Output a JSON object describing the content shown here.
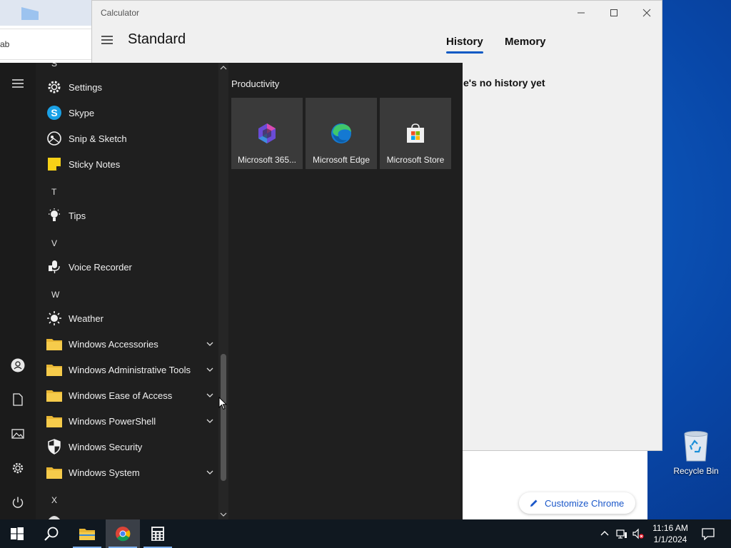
{
  "browser": {
    "address_fragment": "ab",
    "customize_label": "Customize Chrome"
  },
  "calculator": {
    "title": "Calculator",
    "mode": "Standard",
    "tabs": [
      {
        "label": "History",
        "active": true
      },
      {
        "label": "Memory",
        "active": false
      }
    ],
    "history_empty": "e's no history yet"
  },
  "start_menu": {
    "letters": {
      "s": "S",
      "t": "T",
      "v": "V",
      "w": "W",
      "x": "X"
    },
    "apps": [
      {
        "label": "Settings",
        "icon": "gear-icon"
      },
      {
        "label": "Skype",
        "icon": "skype-icon"
      },
      {
        "label": "Snip & Sketch",
        "icon": "snip-sketch-icon"
      },
      {
        "label": "Sticky Notes",
        "icon": "sticky-notes-icon"
      },
      {
        "label": "Tips",
        "icon": "lightbulb-icon"
      },
      {
        "label": "Voice Recorder",
        "icon": "microphone-icon"
      },
      {
        "label": "Weather",
        "icon": "sun-icon"
      },
      {
        "label": "Windows Accessories",
        "icon": "folder-icon",
        "expandable": true
      },
      {
        "label": "Windows Administrative Tools",
        "icon": "folder-icon",
        "expandable": true
      },
      {
        "label": "Windows Ease of Access",
        "icon": "folder-icon",
        "expandable": true
      },
      {
        "label": "Windows PowerShell",
        "icon": "folder-icon",
        "expandable": true
      },
      {
        "label": "Windows Security",
        "icon": "shield-icon"
      },
      {
        "label": "Windows System",
        "icon": "folder-icon",
        "expandable": true
      }
    ],
    "tiles_group": "Productivity",
    "tiles": [
      {
        "label": "Microsoft 365...",
        "icon": "microsoft-365-icon"
      },
      {
        "label": "Microsoft Edge",
        "icon": "edge-icon"
      },
      {
        "label": "Microsoft Store",
        "icon": "store-icon"
      }
    ]
  },
  "desktop": {
    "recycle_bin_label": "Recycle Bin"
  },
  "taskbar": {
    "time": "11:16 AM",
    "date": "1/1/2024"
  },
  "colors": {
    "accent": "#0a59c4",
    "start_bg": "#1f1f1f",
    "tile_bg": "#3a3a3a",
    "taskbar_bg": "#101820"
  }
}
